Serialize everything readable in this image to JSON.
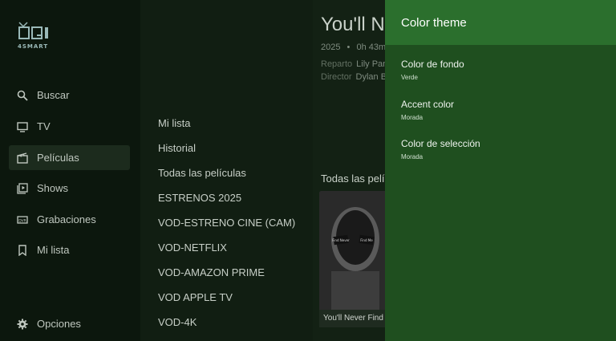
{
  "sidebar": {
    "logo_text": "4SMART",
    "items": [
      {
        "label": "Buscar",
        "icon": "search-icon"
      },
      {
        "label": "TV",
        "icon": "tv-icon"
      },
      {
        "label": "Películas",
        "icon": "clapperboard-icon",
        "active": true
      },
      {
        "label": "Shows",
        "icon": "play-library-icon"
      },
      {
        "label": "Grabaciones",
        "icon": "dvr-icon"
      },
      {
        "label": "Mi lista",
        "icon": "bookmark-icon"
      }
    ],
    "options_label": "Opciones",
    "options_icon": "gear-icon"
  },
  "categories": [
    "Mi lista",
    "Historial",
    "Todas las películas",
    "ESTRENOS 2025",
    "VOD-ESTRENO CINE (CAM)",
    "VOD-NETFLIX",
    "VOD-AMAZON PRIME",
    "VOD APPLE TV",
    "VOD-4K"
  ],
  "main": {
    "movie_title": "You'll Ne",
    "year": "2025",
    "duration": "0h 43m",
    "cast_label": "Reparto",
    "cast_value": "Lily Pan",
    "director_label": "Director",
    "director_value": "Dylan B",
    "section_title": "Todas las pelíc",
    "poster_caption": "You'll Never Find",
    "poster_sign_left": "Find Never",
    "poster_sign_right": "Find Me"
  },
  "drawer": {
    "title": "Color theme",
    "options": [
      {
        "label": "Color de fondo",
        "value": "Verde"
      },
      {
        "label": "Accent color",
        "value": "Morada"
      },
      {
        "label": "Color de selección",
        "value": "Morada"
      }
    ]
  },
  "colors": {
    "drawer_header": "#2b6f2d",
    "drawer_body": "#1f4f1f",
    "background": "#0f1a10"
  }
}
